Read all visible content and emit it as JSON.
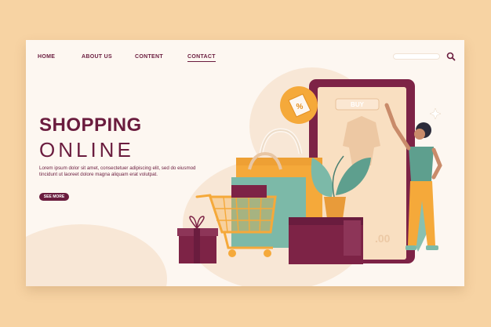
{
  "nav": {
    "items": [
      {
        "label": "HOME"
      },
      {
        "label": "ABOUT US"
      },
      {
        "label": "CONTENT"
      },
      {
        "label": "CONTACT"
      }
    ]
  },
  "hero": {
    "title_line1": "SHOPPING",
    "title_line2": "ONLINE",
    "body": "Lorem ipsum dolor sit amet, consectetuer adipiscing elit, sed do eiusmod tincidunt ut laoreet dolore magna aliquam erat volutpat.",
    "button_label": "SEE MORE"
  },
  "phone": {
    "buy_label": "BUY",
    "price_text": ".00",
    "badge_symbol": "%"
  },
  "colors": {
    "background": "#f7d3a3",
    "card": "#fdf7f1",
    "primary": "#6a1c3e",
    "accent_orange": "#f5a93a",
    "teal": "#7cb9a8"
  },
  "icons": [
    "search-icon",
    "percent-tag-icon",
    "shopping-cart-icon",
    "gift-box-icon",
    "plant-icon"
  ]
}
